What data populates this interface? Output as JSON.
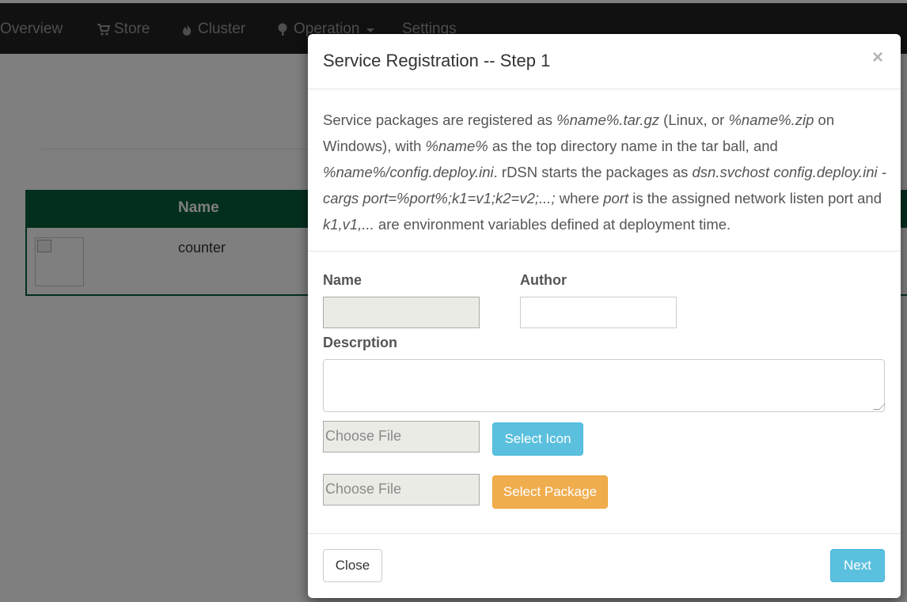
{
  "navbar": {
    "items": [
      {
        "label": "Overview",
        "icon": "overview-icon"
      },
      {
        "label": "Store",
        "icon": "cart-icon"
      },
      {
        "label": "Cluster",
        "icon": "fire-icon"
      },
      {
        "label": "Operation",
        "icon": "tree-icon"
      },
      {
        "label": "Settings"
      }
    ]
  },
  "table": {
    "header_name": "Name",
    "rows": [
      {
        "name": "counter"
      }
    ]
  },
  "modal": {
    "title": "Service Registration -- Step 1",
    "close_symbol": "×",
    "intro": [
      {
        "t": "Service packages are registered as ",
        "i": false
      },
      {
        "t": "%name%.tar.gz",
        "i": true
      },
      {
        "t": " (Linux, or ",
        "i": false
      },
      {
        "t": "%name%.zip",
        "i": true
      },
      {
        "t": " on Windows), with ",
        "i": false
      },
      {
        "t": "%name%",
        "i": true
      },
      {
        "t": " as the top directory name in the tar ball, and ",
        "i": false
      },
      {
        "t": "%name%/config.deploy.ini",
        "i": true
      },
      {
        "t": ". rDSN starts the packages as ",
        "i": false
      },
      {
        "t": "dsn.svchost config.deploy.ini -cargs port=%port%;k1=v1;k2=v2;...;",
        "i": true
      },
      {
        "t": " where ",
        "i": false
      },
      {
        "t": "port",
        "i": true
      },
      {
        "t": " is the assigned network listen port and ",
        "i": false
      },
      {
        "t": "k1,v1,...",
        "i": true
      },
      {
        "t": " are environment variables defined at deployment time.",
        "i": false
      }
    ],
    "form": {
      "name_label": "Name",
      "name_value": "",
      "author_label": "Author",
      "author_value": "",
      "description_label": "Descrption",
      "description_value": "",
      "icon_file_text": "Choose File",
      "select_icon_label": "Select Icon",
      "package_file_text": "Choose File",
      "select_package_label": "Select Package"
    },
    "footer": {
      "close_label": "Close",
      "next_label": "Next"
    }
  },
  "colors": {
    "navbar_bg": "#222222",
    "table_header_bg": "#075e3a",
    "info_button": "#5bc0de",
    "warning_button": "#f0ad4e"
  }
}
